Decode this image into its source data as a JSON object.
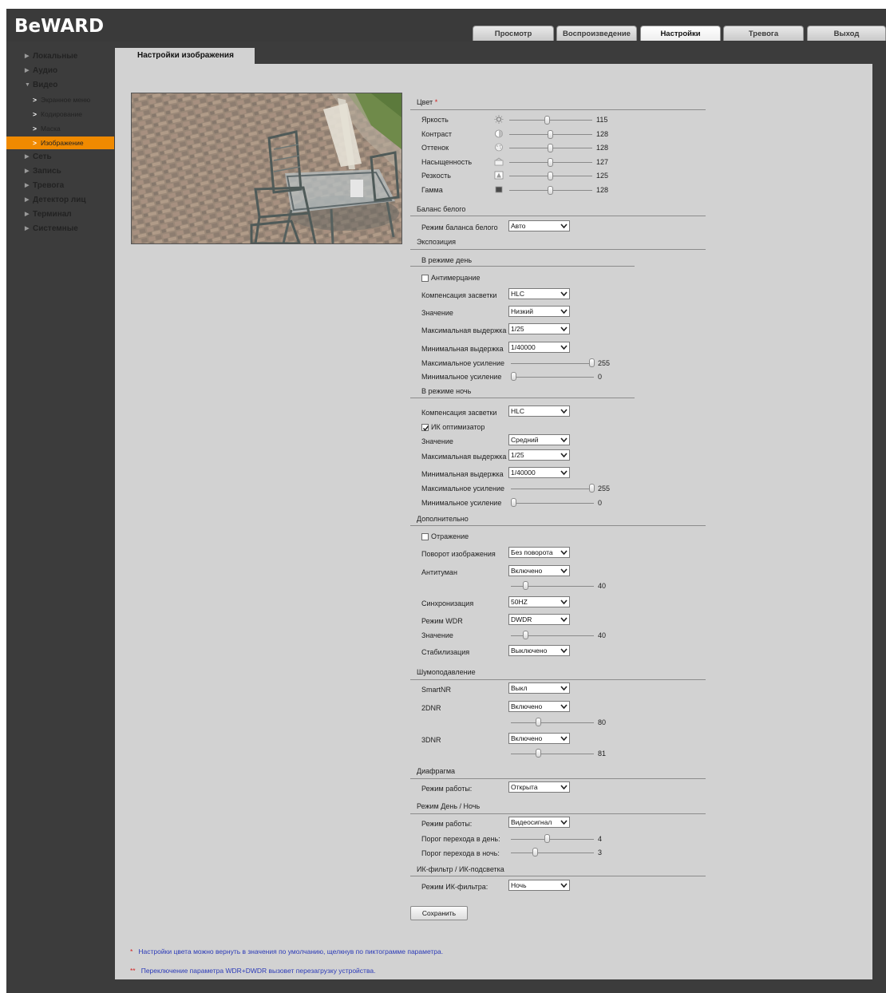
{
  "app": {
    "logo": "BeWARD"
  },
  "tabs": [
    {
      "label": "Просмотр",
      "active": false
    },
    {
      "label": "Воспроизведение",
      "active": false
    },
    {
      "label": "Настройки",
      "active": true
    },
    {
      "label": "Тревога",
      "active": false
    },
    {
      "label": "Выход",
      "active": false
    }
  ],
  "sidebar": {
    "items": [
      {
        "label": "Локальные"
      },
      {
        "label": "Аудио"
      },
      {
        "label": "Видео",
        "expanded": true
      },
      {
        "label": "Сеть"
      },
      {
        "label": "Запись"
      },
      {
        "label": "Тревога"
      },
      {
        "label": "Детектор лиц"
      },
      {
        "label": "Терминал"
      },
      {
        "label": "Системные"
      }
    ],
    "sub": [
      {
        "label": "Экранное меню"
      },
      {
        "label": "Кодирование"
      },
      {
        "label": "Маска"
      },
      {
        "label": "Изображение",
        "active": true
      }
    ]
  },
  "page_title": "Настройки изображения",
  "color": {
    "title": "Цвет",
    "star": "*",
    "brightness": {
      "label": "Яркость",
      "value": "115"
    },
    "contrast": {
      "label": "Контраст",
      "value": "128"
    },
    "hue": {
      "label": "Оттенок",
      "value": "128"
    },
    "saturation": {
      "label": "Насыщенность",
      "value": "127"
    },
    "sharpness": {
      "label": "Резкость",
      "value": "125"
    },
    "gamma": {
      "label": "Гамма",
      "value": "128"
    }
  },
  "wb": {
    "title": "Баланс белого",
    "mode_label": "Режим баланса белого",
    "mode_value": "Авто"
  },
  "exposure": {
    "title": "Экспозиция",
    "day": {
      "title": "В режиме день",
      "antiflicker": "Антимерцание",
      "backlight_label": "Компенсация засветки",
      "backlight_value": "HLC",
      "value_label": "Значение",
      "value_value": "Низкий",
      "max_shutter_label": "Максимальная выдержка",
      "max_shutter_value": "1/25",
      "min_shutter_label": "Минимальная выдержка",
      "min_shutter_value": "1/40000",
      "max_gain_label": "Максимальное усиление",
      "max_gain_value": "255",
      "min_gain_label": "Минимальное усиление",
      "min_gain_value": "0"
    },
    "night": {
      "title": "В режиме ночь",
      "backlight_label": "Компенсация засветки",
      "backlight_value": "HLC",
      "ir_opt": "ИК оптимизатор",
      "value_label": "Значение",
      "value_value": "Средний",
      "max_shutter_label": "Максимальная выдержка",
      "max_shutter_value": "1/25",
      "min_shutter_label": "Минимальная выдержка",
      "min_shutter_value": "1/40000",
      "max_gain_label": "Максимальное усиление",
      "max_gain_value": "255",
      "min_gain_label": "Минимальное усиление",
      "min_gain_value": "0"
    }
  },
  "extra": {
    "title": "Дополнительно",
    "mirror": "Отражение",
    "rotate_label": "Поворот изображения",
    "rotate_value": "Без поворота",
    "defog_label": "Антитуман",
    "defog_value": "Включено",
    "defog_level": "40",
    "sync_label": "Синхронизация",
    "sync_value": "50HZ",
    "wdr_label": "Режим WDR",
    "wdr_value": "DWDR",
    "wdr_level_label": "Значение",
    "wdr_level": "40",
    "stab_label": "Стабилизация",
    "stab_value": "Выключено"
  },
  "noise": {
    "title": "Шумоподавление",
    "smartnr_label": "SmartNR",
    "smartnr_value": "Выкл",
    "dnr2_label": "2DNR",
    "dnr2_value": "Включено",
    "dnr2_level": "80",
    "dnr3_label": "3DNR",
    "dnr3_value": "Включено",
    "dnr3_level": "81"
  },
  "iris": {
    "title": "Диафрагма",
    "mode_label": "Режим работы:",
    "mode_value": "Открыта"
  },
  "daynight": {
    "title": "Режим День / Ночь",
    "mode_label": "Режим работы:",
    "mode_value": "Видеосигнал",
    "day_thr_label": "Порог перехода в день:",
    "day_thr_value": "4",
    "night_thr_label": "Порог перехода в ночь:",
    "night_thr_value": "3"
  },
  "ircut": {
    "title": "ИК-фильтр / ИК-подсветка",
    "mode_label": "Режим ИК-фильтра:",
    "mode_value": "Ночь"
  },
  "save_label": "Сохранить",
  "notes": {
    "star1": "*",
    "note1": "Настройки цвета можно вернуть в значения по умолчанию, щелкнув по пиктограмме параметра.",
    "star2": "**",
    "note2": "Переключение параметра WDR+DWDR вызовет перезагрузку устройства."
  },
  "colors": {
    "accent": "#f08a00",
    "note": "#2b3ab8",
    "panel": "#d2d2d2"
  }
}
